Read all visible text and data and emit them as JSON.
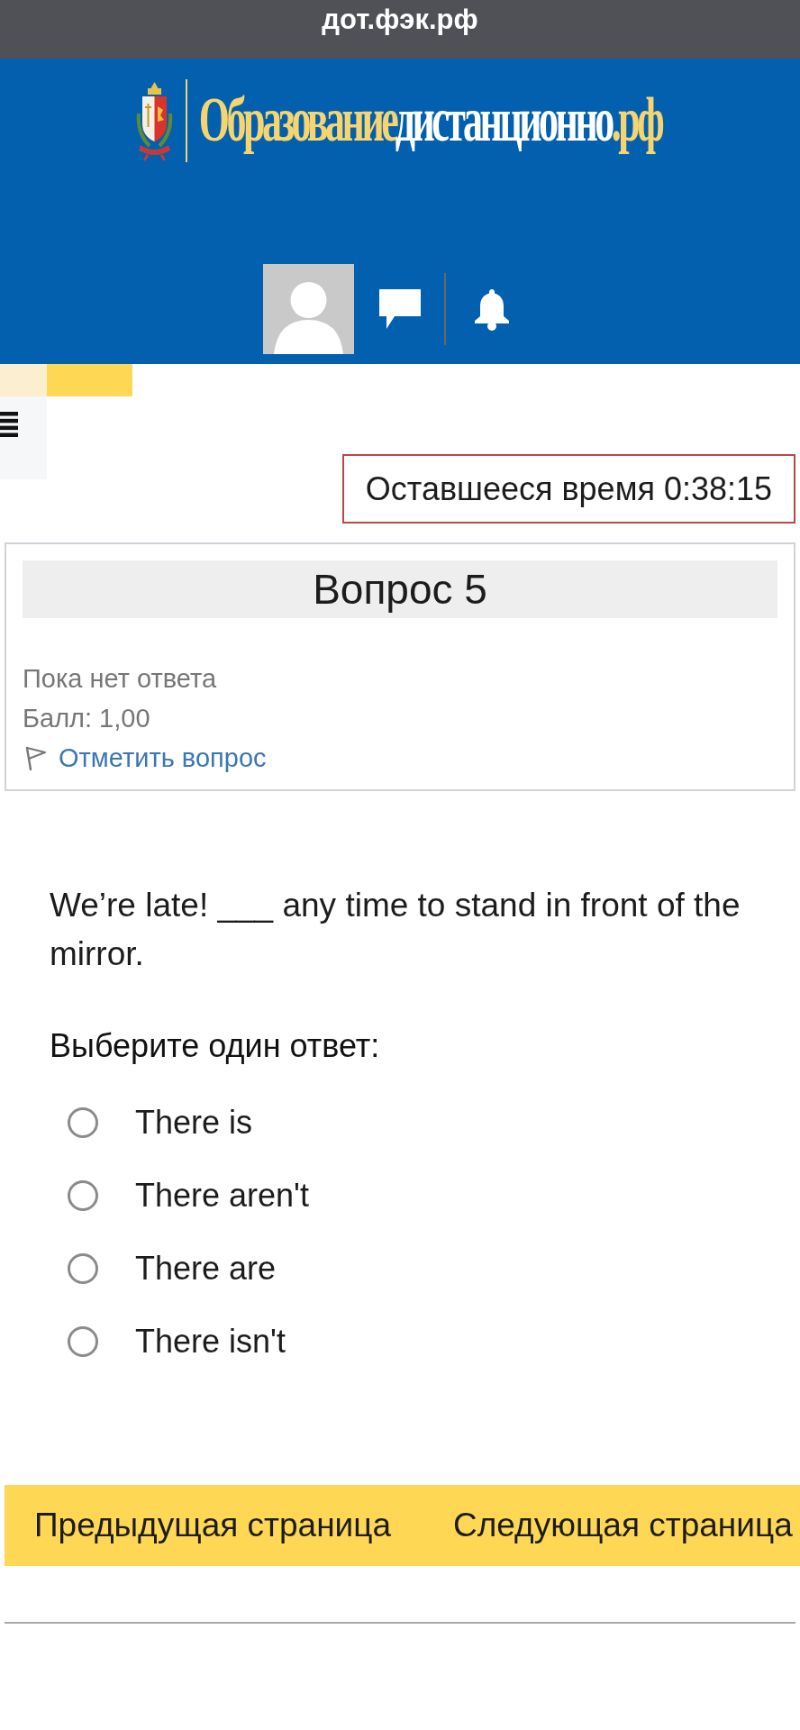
{
  "browser_bar": {
    "url": "дот.фэк.рф"
  },
  "header": {
    "logo_parts": [
      "Образование",
      "дистанционно",
      ".рф"
    ]
  },
  "timer": {
    "text": "Оставшееся время 0:38:15"
  },
  "question_card": {
    "title": "Вопрос 5",
    "status": "Пока нет ответа",
    "score": "Балл: 1,00",
    "flag_link": "Отметить вопрос"
  },
  "question": {
    "text": "We’re late! ___ any time to stand in front of the mirror.",
    "prompt": "Выберите один ответ:",
    "options": [
      {
        "label": "There is",
        "selected": false
      },
      {
        "label": "There aren't",
        "selected": false
      },
      {
        "label": "There are",
        "selected": false
      },
      {
        "label": "There isn't",
        "selected": false
      }
    ]
  },
  "navigation": {
    "buttons": [
      "Предыдущая страница",
      "Следующая страница"
    ]
  }
}
